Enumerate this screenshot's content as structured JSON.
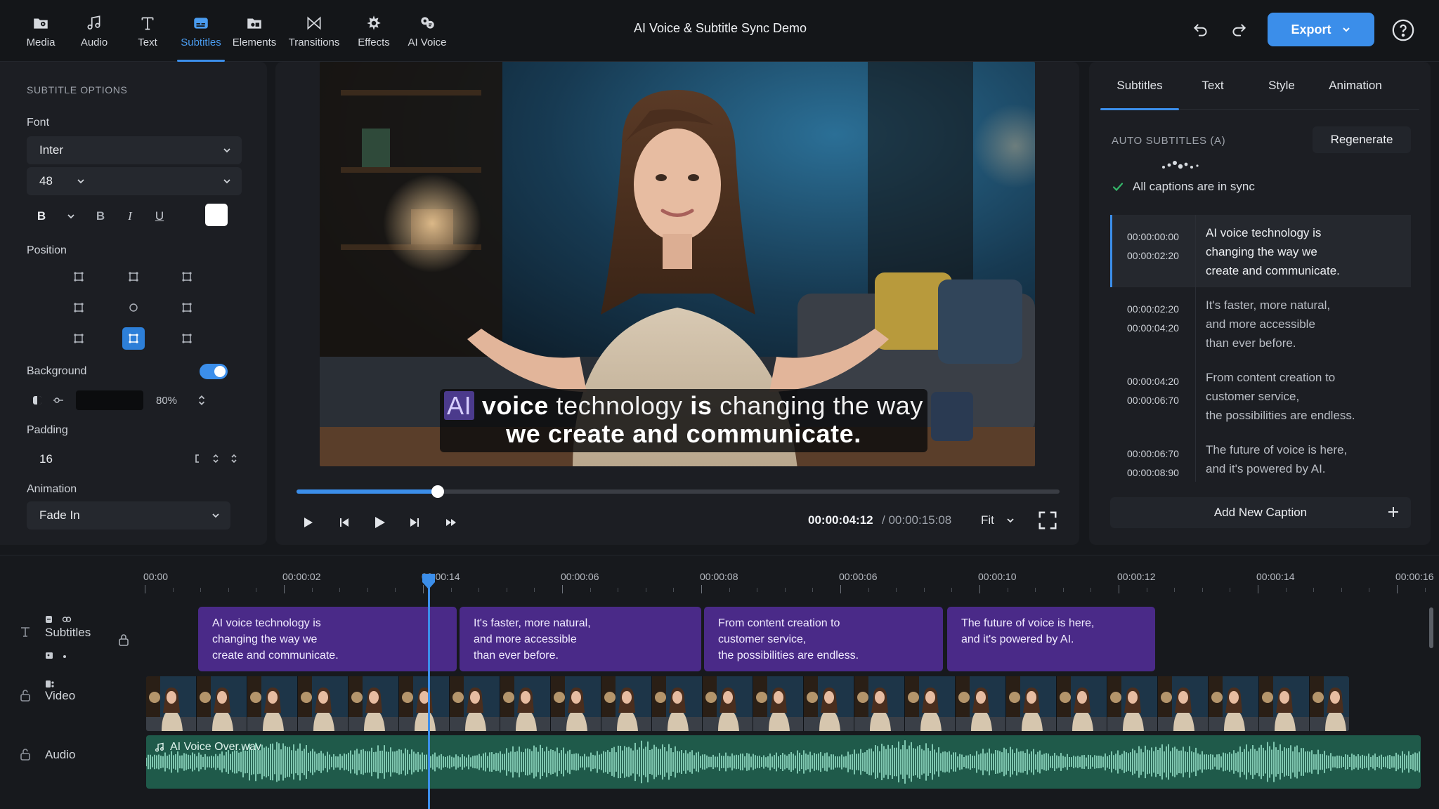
{
  "app": {
    "title": "AI Voice & Subtitle Sync Demo"
  },
  "toolbar": {
    "tools": [
      {
        "id": "media",
        "label": "Media",
        "icon": "media-icon"
      },
      {
        "id": "audio",
        "label": "Audio",
        "icon": "music-note-icon"
      },
      {
        "id": "text",
        "label": "Text",
        "icon": "text-icon"
      },
      {
        "id": "subtitles",
        "label": "Subtitles",
        "icon": "subtitles-icon",
        "active": true
      },
      {
        "id": "elements",
        "label": "Elements",
        "icon": "elements-icon"
      },
      {
        "id": "transitions",
        "label": "Transitions",
        "icon": "transitions-icon"
      },
      {
        "id": "effects",
        "label": "Effects",
        "icon": "effects-icon"
      },
      {
        "id": "ai-voice",
        "label": "AI Voice",
        "icon": "ai-voice-icon"
      }
    ],
    "export_label": "Export",
    "accent": "#3b8eea"
  },
  "subtitle_options": {
    "heading": "SUBTITLE OPTIONS",
    "font_label": "Font",
    "font_value": "Inter",
    "size_value": "48",
    "format": {
      "bold": "B",
      "italic": "I",
      "underline": "U"
    },
    "text_color": "#ffffff",
    "position_label": "Position",
    "position_selected": "bottom-center",
    "background_label": "Background",
    "background_enabled": true,
    "background_color": "#0b0c0e",
    "background_opacity": "80%",
    "padding_label": "Padding",
    "padding_value": "16",
    "animation_label": "Animation",
    "animation_value": "Fade In"
  },
  "preview": {
    "caption": {
      "highlight_word": "AI",
      "w1": "voice",
      "w2": "technology",
      "w3": "is",
      "w4": "changing",
      "w5": "the way",
      "line2": "we create and communicate."
    },
    "progress_fraction": 0.185,
    "current_time": "00:00:04:12",
    "total_time": "/ 00:00:15:08",
    "zoom": "Fit"
  },
  "right_panel": {
    "tabs": [
      {
        "label": "Subtitles",
        "active": true
      },
      {
        "label": "Text"
      },
      {
        "label": "Style"
      },
      {
        "label": "Animation"
      }
    ],
    "heading": "AUTO SUBTITLES (A)",
    "regenerate_label": "Regenerate",
    "sync_status": "All captions are in sync",
    "captions": [
      {
        "start": "00:00:00:00",
        "end": "00:00:02:20",
        "lines": [
          "AI voice technology is",
          "changing the way we",
          "create and communicate."
        ],
        "active": true
      },
      {
        "start": "00:00:02:20",
        "end": "00:00:04:20",
        "lines": [
          "It's faster, more natural,",
          "and more accessible",
          "than ever before."
        ]
      },
      {
        "start": "00:00:04:20",
        "end": "00:00:06:70",
        "lines": [
          "From content creation to",
          "customer service,",
          "the possibilities are endless."
        ]
      },
      {
        "start": "00:00:06:70",
        "end": "00:00:08:90",
        "lines": [
          "The future of voice is here,",
          "and it's powered by AI."
        ]
      }
    ],
    "add_caption_label": "Add New Caption"
  },
  "timeline": {
    "ruler_labels": [
      "00:00",
      "00:00:02",
      "00:00:14",
      "00:00:06",
      "00:00:08",
      "00:00:06",
      "00:00:10",
      "00:00:12",
      "00:00:14",
      "00:00:16"
    ],
    "tracks": {
      "subtitles_label": "Subtitles",
      "video_label": "Video",
      "audio_label": "Audio"
    },
    "subtitle_clips": [
      {
        "lines": [
          "AI voice technology is",
          "changing the way we",
          "create and communicate."
        ]
      },
      {
        "lines": [
          "It's faster, more natural,",
          "and more accessible",
          "than ever before."
        ]
      },
      {
        "lines": [
          "From content creation to",
          "customer service,",
          "the possibilities are endless."
        ]
      },
      {
        "lines": [
          "The future of voice is here,",
          "and it's powered by AI."
        ]
      }
    ],
    "audio_file": "AI Voice Over.wav",
    "subtitle_color": "#4a2a88",
    "audio_color": "#1f5a4a"
  }
}
